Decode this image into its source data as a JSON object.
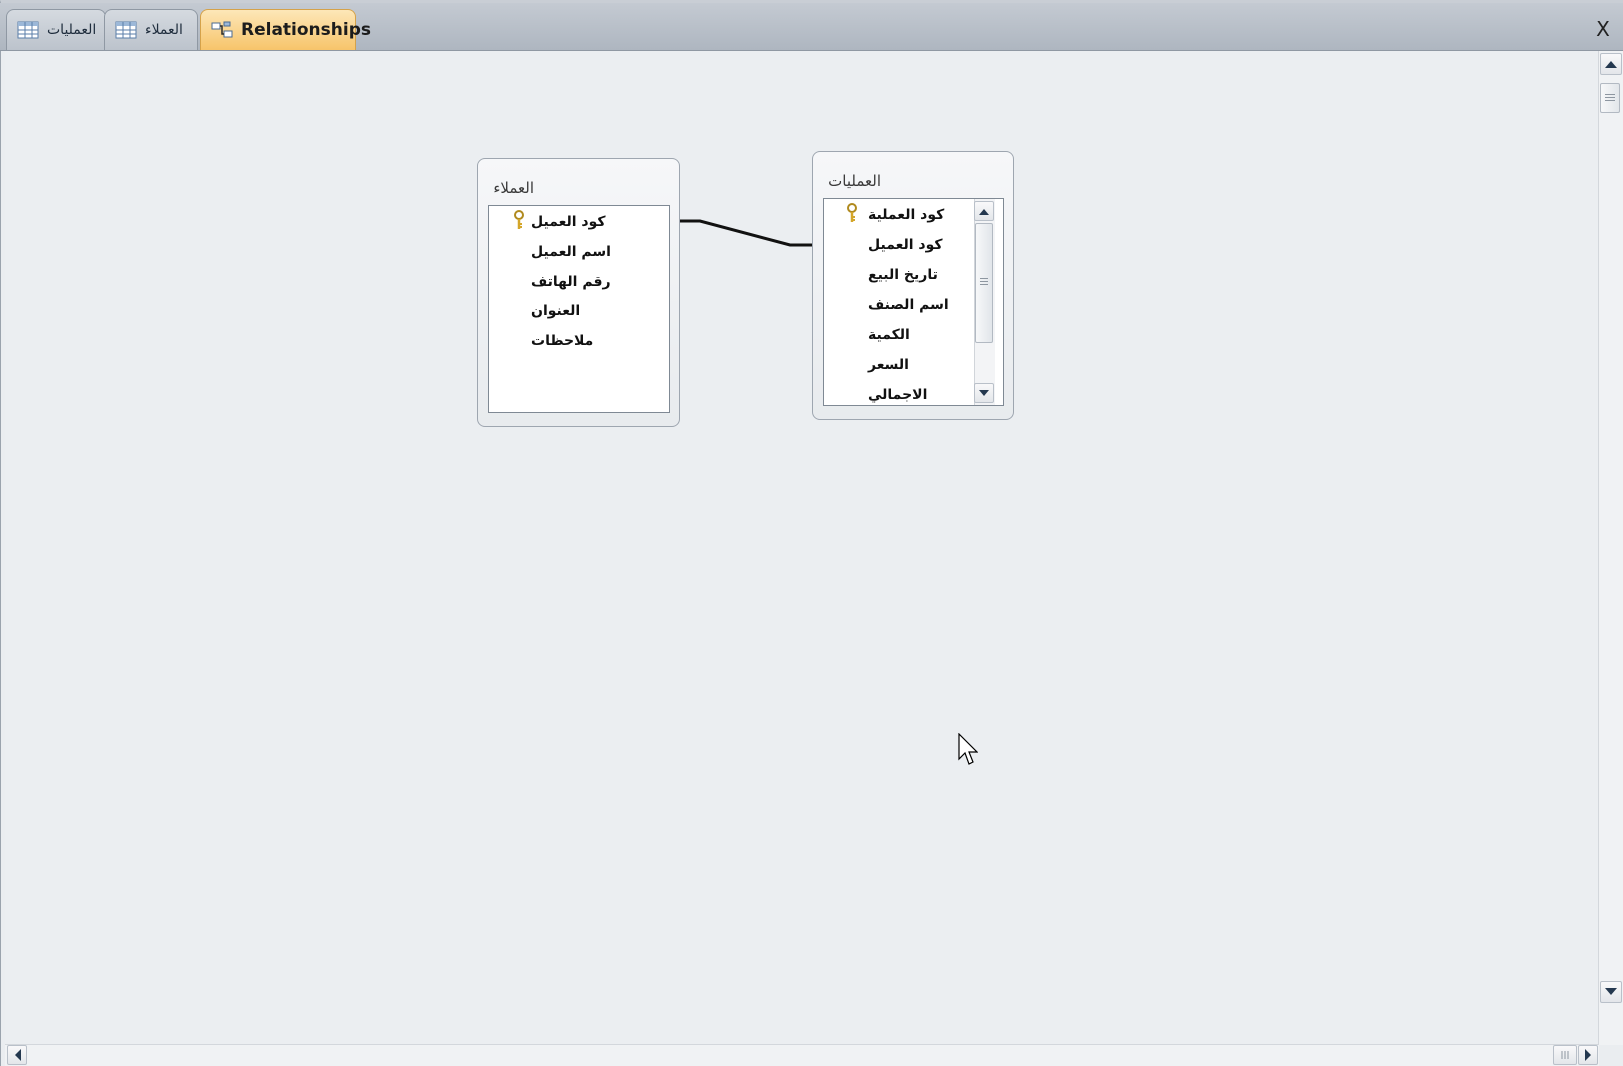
{
  "tabs": [
    {
      "label": "العمليات",
      "icon": "table-icon",
      "active": false
    },
    {
      "label": "العملاء",
      "icon": "table-icon",
      "active": false
    },
    {
      "label": "Relationships",
      "icon": "relationships-icon",
      "active": true
    }
  ],
  "close_label": "X",
  "tables": {
    "customers": {
      "title": "العملاء",
      "fields": [
        {
          "name": "كود العميل",
          "primary_key": true
        },
        {
          "name": "اسم العميل",
          "primary_key": false
        },
        {
          "name": "رقم الهاتف",
          "primary_key": false
        },
        {
          "name": "العنوان",
          "primary_key": false
        },
        {
          "name": "ملاحظات",
          "primary_key": false
        }
      ]
    },
    "operations": {
      "title": "العمليات",
      "fields": [
        {
          "name": "كود العملية",
          "primary_key": true
        },
        {
          "name": "كود العميل",
          "primary_key": false
        },
        {
          "name": "تاريخ البيع",
          "primary_key": false
        },
        {
          "name": "اسم الصنف",
          "primary_key": false
        },
        {
          "name": "الكمية",
          "primary_key": false
        },
        {
          "name": "السعر",
          "primary_key": false
        },
        {
          "name": "الاجمالي",
          "primary_key": false
        }
      ]
    }
  },
  "relationship": {
    "from": "العملاء.كود العميل",
    "to": "العمليات.كود العميل"
  },
  "colors": {
    "active_tab": "#f7c46a",
    "canvas": "#ebeef1",
    "key_icon": "#d4a62a"
  }
}
